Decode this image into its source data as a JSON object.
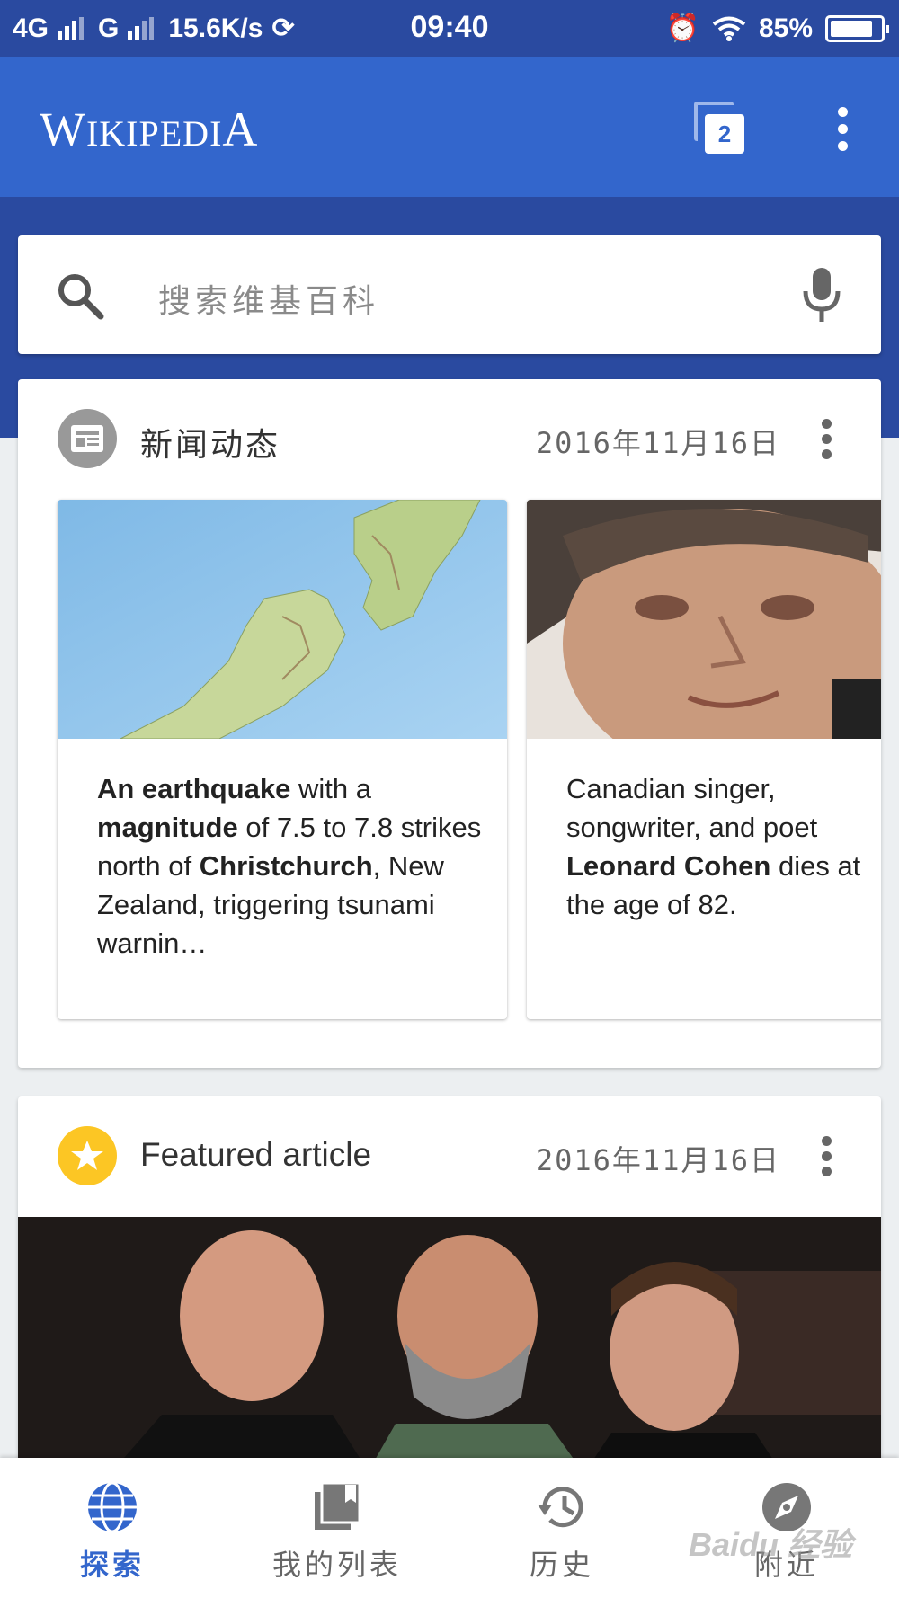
{
  "status_bar": {
    "network_1": "4G",
    "network_2": "G",
    "speed": "15.6K/s",
    "time": "09:40",
    "battery": "85%",
    "battery_level": 0.85
  },
  "app_bar": {
    "logo": "Wikipedia",
    "tab_count": "2",
    "menu_icon": "more-vert-icon"
  },
  "search": {
    "placeholder": "搜索维基百科",
    "icon": "search-icon",
    "voice_icon": "mic-icon"
  },
  "news_card": {
    "title": "新闻动态",
    "date": "2016年11月16日",
    "icon": "newspaper-icon",
    "items": [
      {
        "image": "new-zealand-map",
        "parts": [
          {
            "text": "An earthquake",
            "bold": true
          },
          {
            "text": " with a ",
            "bold": false
          },
          {
            "text": "magnitude",
            "bold": true
          },
          {
            "text": " of 7.5 to 7.8 strikes north of ",
            "bold": false
          },
          {
            "text": "Christchurch",
            "bold": true
          },
          {
            "text": ", New Zealand, triggering tsunami warnin…",
            "bold": false
          }
        ]
      },
      {
        "image": "portrait-photo",
        "parts": [
          {
            "text": "Canadian singer, songwriter, and poet ",
            "bold": false
          },
          {
            "text": "Leonard Cohen",
            "bold": true
          },
          {
            "text": " dies at the age of 82.",
            "bold": false
          }
        ]
      }
    ]
  },
  "featured_card": {
    "title": "Featured article",
    "date": "2016年11月16日",
    "icon": "star-icon",
    "image": "group-photo"
  },
  "bottom_nav": {
    "items": [
      {
        "label": "探索",
        "icon": "globe-icon",
        "active": true
      },
      {
        "label": "我的列表",
        "icon": "reading-list-icon",
        "active": false
      },
      {
        "label": "历史",
        "icon": "history-icon",
        "active": false
      },
      {
        "label": "附近",
        "icon": "nearby-compass-icon",
        "active": false
      }
    ]
  },
  "watermark": "Baidu 经验"
}
